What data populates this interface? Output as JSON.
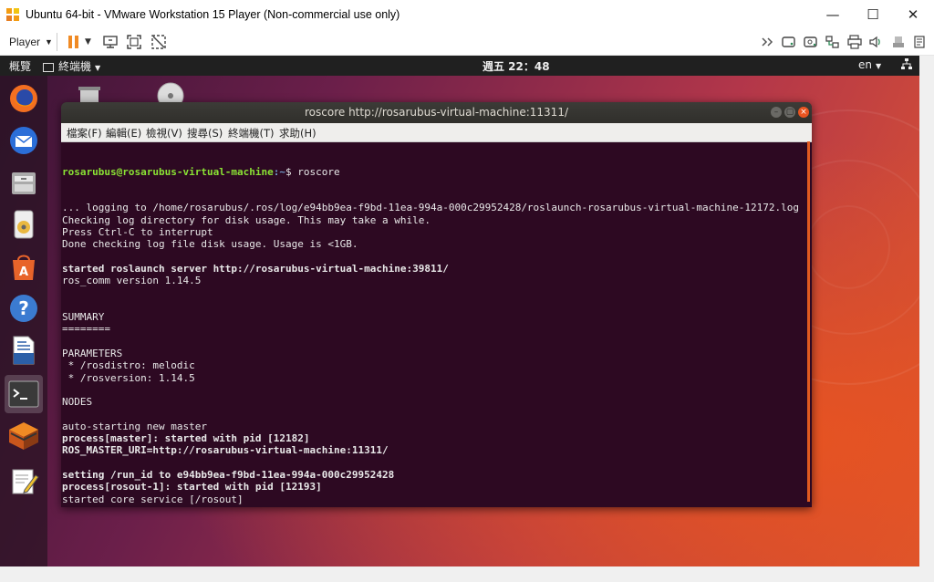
{
  "vmware": {
    "title": "Ubuntu 64-bit - VMware Workstation 15 Player (Non-commercial use only)",
    "player_menu": "Player",
    "colors": {
      "accent": "#f08a24"
    }
  },
  "gnome": {
    "activities": "概覽",
    "app_menu": "終端機",
    "clock": "週五 22：48",
    "lang": "en"
  },
  "dock_icons": [
    "firefox-icon",
    "thunderbird-icon",
    "files-icon",
    "rhythmbox-icon",
    "software-center-icon",
    "help-icon",
    "writer-icon",
    "terminal-icon",
    "ros-box-icon",
    "text-editor-icon"
  ],
  "terminal": {
    "title": "roscore http://rosarubus-virtual-machine:11311/",
    "menu": [
      "檔案(F)",
      "編輯(E)",
      "檢視(V)",
      "搜尋(S)",
      "終端機(T)",
      "求助(H)"
    ],
    "prompt_user": "rosarubus@rosarubus-virtual-machine",
    "prompt_path": ":~",
    "prompt_cmd": "$ roscore",
    "lines": [
      {
        "text": "... logging to /home/rosarubus/.ros/log/e94bb9ea-f9bd-11ea-994a-000c29952428/roslaunch-rosarubus-virtual-machine-12172.log",
        "bold": false
      },
      {
        "text": "Checking log directory for disk usage. This may take a while.",
        "bold": false
      },
      {
        "text": "Press Ctrl-C to interrupt",
        "bold": false
      },
      {
        "text": "Done checking log file disk usage. Usage is <1GB.",
        "bold": false
      },
      {
        "text": "",
        "bold": false
      },
      {
        "text": "started roslaunch server http://rosarubus-virtual-machine:39811/",
        "bold": true
      },
      {
        "text": "ros_comm version 1.14.5",
        "bold": false
      },
      {
        "text": "",
        "bold": false
      },
      {
        "text": "",
        "bold": false
      },
      {
        "text": "SUMMARY",
        "bold": false
      },
      {
        "text": "========",
        "bold": false
      },
      {
        "text": "",
        "bold": false
      },
      {
        "text": "PARAMETERS",
        "bold": false
      },
      {
        "text": " * /rosdistro: melodic",
        "bold": false
      },
      {
        "text": " * /rosversion: 1.14.5",
        "bold": false
      },
      {
        "text": "",
        "bold": false
      },
      {
        "text": "NODES",
        "bold": false
      },
      {
        "text": "",
        "bold": false
      },
      {
        "text": "auto-starting new master",
        "bold": false
      },
      {
        "text": "process[master]: started with pid [12182]",
        "bold": true
      },
      {
        "text": "ROS_MASTER_URI=http://rosarubus-virtual-machine:11311/",
        "bold": true
      },
      {
        "text": "",
        "bold": false
      },
      {
        "text": "setting /run_id to e94bb9ea-f9bd-11ea-994a-000c29952428",
        "bold": true
      },
      {
        "text": "process[rosout-1]: started with pid [12193]",
        "bold": true
      },
      {
        "text": "started core service [/rosout]",
        "bold": false
      }
    ]
  }
}
